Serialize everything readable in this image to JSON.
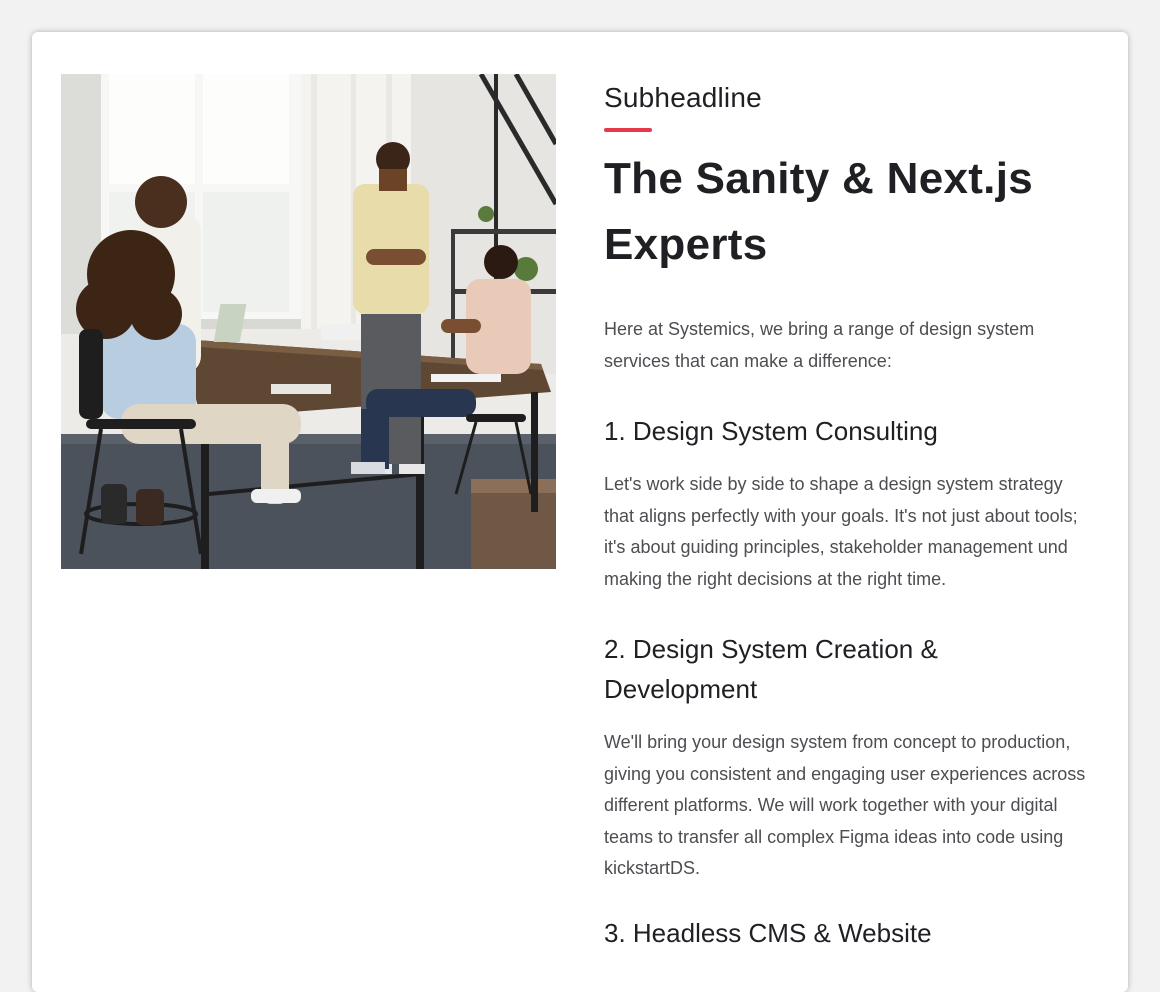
{
  "colors": {
    "accent": "#e8394a",
    "heading": "#1f1f24",
    "body_text": "#4d4d52",
    "card_background": "#ffffff"
  },
  "media": {
    "image_kind": "office-team-photo"
  },
  "content": {
    "subheadline": "Subheadline",
    "headline": "The Sanity & Next.js Experts",
    "intro": "Here at Systemics, we bring a range of design system services that can make a difference:",
    "sections": [
      {
        "title": "1. Design System Consulting",
        "text": "Let's work side by side to shape a design system strategy that aligns perfectly with your goals. It's not just about tools; it's about guiding principles, stakeholder management und making the right decisions at the right time."
      },
      {
        "title": "2. Design System Creation & Development",
        "text": "We'll bring your design system from concept to production, giving you consistent and engaging user experiences across different platforms. We will work together with your digital teams to transfer all complex Figma ideas into code using kickstartDS."
      },
      {
        "title": "3. Headless CMS & Website"
      }
    ]
  }
}
